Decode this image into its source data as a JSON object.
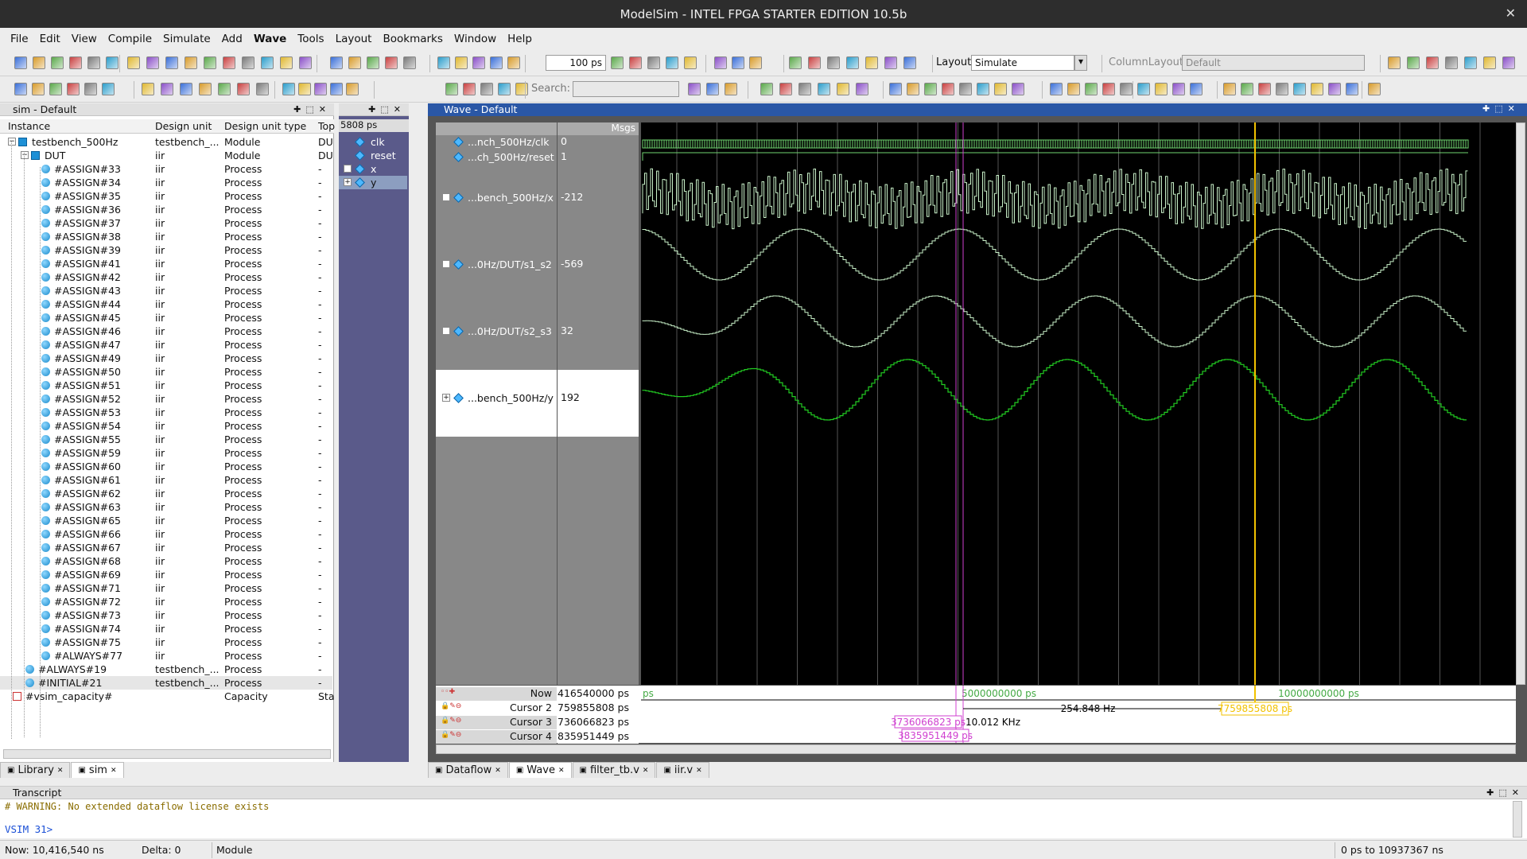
{
  "window": {
    "title": "ModelSim - INTEL FPGA STARTER EDITION 10.5b"
  },
  "menu": [
    "File",
    "Edit",
    "View",
    "Compile",
    "Simulate",
    "Add",
    "Wave",
    "Tools",
    "Layout",
    "Bookmarks",
    "Window",
    "Help"
  ],
  "toolbar": {
    "runtime_value": "100",
    "runtime_unit": "ps",
    "layout_label": "Layout",
    "layout_value": "Simulate",
    "column_layout_label": "ColumnLayout",
    "column_layout_value": "Default",
    "search_label": "Search:",
    "search_placeholder": ""
  },
  "sim_panel": {
    "title": "sim - Default",
    "columns": [
      "Instance",
      "Design unit",
      "Design unit type",
      "Top"
    ],
    "rows": [
      {
        "instance": "testbench_500Hz",
        "unit": "testbench_...",
        "type": "Module",
        "top": "DU",
        "icon": "module-icon",
        "level": 0
      },
      {
        "instance": "DUT",
        "unit": "iir",
        "type": "Module",
        "top": "DU",
        "icon": "module-icon",
        "level": 1
      },
      {
        "instance": "#ASSIGN#33",
        "unit": "iir",
        "type": "Process",
        "top": "-",
        "level": 2
      },
      {
        "instance": "#ASSIGN#34",
        "unit": "iir",
        "type": "Process",
        "top": "-",
        "level": 2
      },
      {
        "instance": "#ASSIGN#35",
        "unit": "iir",
        "type": "Process",
        "top": "-",
        "level": 2
      },
      {
        "instance": "#ASSIGN#36",
        "unit": "iir",
        "type": "Process",
        "top": "-",
        "level": 2
      },
      {
        "instance": "#ASSIGN#37",
        "unit": "iir",
        "type": "Process",
        "top": "-",
        "level": 2
      },
      {
        "instance": "#ASSIGN#38",
        "unit": "iir",
        "type": "Process",
        "top": "-",
        "level": 2
      },
      {
        "instance": "#ASSIGN#39",
        "unit": "iir",
        "type": "Process",
        "top": "-",
        "level": 2
      },
      {
        "instance": "#ASSIGN#41",
        "unit": "iir",
        "type": "Process",
        "top": "-",
        "level": 2
      },
      {
        "instance": "#ASSIGN#42",
        "unit": "iir",
        "type": "Process",
        "top": "-",
        "level": 2
      },
      {
        "instance": "#ASSIGN#43",
        "unit": "iir",
        "type": "Process",
        "top": "-",
        "level": 2
      },
      {
        "instance": "#ASSIGN#44",
        "unit": "iir",
        "type": "Process",
        "top": "-",
        "level": 2
      },
      {
        "instance": "#ASSIGN#45",
        "unit": "iir",
        "type": "Process",
        "top": "-",
        "level": 2
      },
      {
        "instance": "#ASSIGN#46",
        "unit": "iir",
        "type": "Process",
        "top": "-",
        "level": 2
      },
      {
        "instance": "#ASSIGN#47",
        "unit": "iir",
        "type": "Process",
        "top": "-",
        "level": 2
      },
      {
        "instance": "#ASSIGN#49",
        "unit": "iir",
        "type": "Process",
        "top": "-",
        "level": 2
      },
      {
        "instance": "#ASSIGN#50",
        "unit": "iir",
        "type": "Process",
        "top": "-",
        "level": 2
      },
      {
        "instance": "#ASSIGN#51",
        "unit": "iir",
        "type": "Process",
        "top": "-",
        "level": 2
      },
      {
        "instance": "#ASSIGN#52",
        "unit": "iir",
        "type": "Process",
        "top": "-",
        "level": 2
      },
      {
        "instance": "#ASSIGN#53",
        "unit": "iir",
        "type": "Process",
        "top": "-",
        "level": 2
      },
      {
        "instance": "#ASSIGN#54",
        "unit": "iir",
        "type": "Process",
        "top": "-",
        "level": 2
      },
      {
        "instance": "#ASSIGN#55",
        "unit": "iir",
        "type": "Process",
        "top": "-",
        "level": 2
      },
      {
        "instance": "#ASSIGN#59",
        "unit": "iir",
        "type": "Process",
        "top": "-",
        "level": 2
      },
      {
        "instance": "#ASSIGN#60",
        "unit": "iir",
        "type": "Process",
        "top": "-",
        "level": 2
      },
      {
        "instance": "#ASSIGN#61",
        "unit": "iir",
        "type": "Process",
        "top": "-",
        "level": 2
      },
      {
        "instance": "#ASSIGN#62",
        "unit": "iir",
        "type": "Process",
        "top": "-",
        "level": 2
      },
      {
        "instance": "#ASSIGN#63",
        "unit": "iir",
        "type": "Process",
        "top": "-",
        "level": 2
      },
      {
        "instance": "#ASSIGN#65",
        "unit": "iir",
        "type": "Process",
        "top": "-",
        "level": 2
      },
      {
        "instance": "#ASSIGN#66",
        "unit": "iir",
        "type": "Process",
        "top": "-",
        "level": 2
      },
      {
        "instance": "#ASSIGN#67",
        "unit": "iir",
        "type": "Process",
        "top": "-",
        "level": 2
      },
      {
        "instance": "#ASSIGN#68",
        "unit": "iir",
        "type": "Process",
        "top": "-",
        "level": 2
      },
      {
        "instance": "#ASSIGN#69",
        "unit": "iir",
        "type": "Process",
        "top": "-",
        "level": 2
      },
      {
        "instance": "#ASSIGN#71",
        "unit": "iir",
        "type": "Process",
        "top": "-",
        "level": 2
      },
      {
        "instance": "#ASSIGN#72",
        "unit": "iir",
        "type": "Process",
        "top": "-",
        "level": 2
      },
      {
        "instance": "#ASSIGN#73",
        "unit": "iir",
        "type": "Process",
        "top": "-",
        "level": 2
      },
      {
        "instance": "#ASSIGN#74",
        "unit": "iir",
        "type": "Process",
        "top": "-",
        "level": 2
      },
      {
        "instance": "#ASSIGN#75",
        "unit": "iir",
        "type": "Process",
        "top": "-",
        "level": 2
      },
      {
        "instance": "#ALWAYS#77",
        "unit": "iir",
        "type": "Process",
        "top": "-",
        "level": 2
      },
      {
        "instance": "#ALWAYS#19",
        "unit": "testbench_...",
        "type": "Process",
        "top": "-",
        "level": 1
      },
      {
        "instance": "#INITIAL#21",
        "unit": "testbench_...",
        "type": "Process",
        "top": "-",
        "level": 1,
        "selected": true
      },
      {
        "instance": "#vsim_capacity#",
        "unit": "",
        "type": "Capacity",
        "top": "Sta",
        "icon": "capacity-icon",
        "level": 0
      }
    ]
  },
  "objects_panel": {
    "now_value": "5808 ps",
    "signals": [
      {
        "name": "clk",
        "expandable": false
      },
      {
        "name": "reset",
        "expandable": false
      },
      {
        "name": "x",
        "expandable": true
      },
      {
        "name": "y",
        "expandable": true,
        "selected": true
      }
    ]
  },
  "wave_panel": {
    "title": "Wave - Default",
    "msgs_header": "Msgs",
    "signals": [
      {
        "name": "...nch_500Hz/clk",
        "value": "0",
        "expandable": false
      },
      {
        "name": "...ch_500Hz/reset",
        "value": "1",
        "expandable": false
      },
      {
        "name": "...bench_500Hz/x",
        "value": "-212",
        "expandable": true
      },
      {
        "name": "...0Hz/DUT/s1_s2",
        "value": "-569",
        "expandable": true
      },
      {
        "name": "...0Hz/DUT/s2_s3",
        "value": "32",
        "expandable": true
      },
      {
        "name": "...bench_500Hz/y",
        "value": "192",
        "expandable": true,
        "selected": true
      }
    ],
    "cursors": [
      {
        "name": "Now",
        "value": "416540000 ps"
      },
      {
        "name": "Cursor 2",
        "value": "759855808 ps"
      },
      {
        "name": "Cursor 3",
        "value": "736066823 ps"
      },
      {
        "name": "Cursor 4",
        "value": "835951449 ps"
      }
    ],
    "timeline": {
      "ps_label": "ps",
      "tick1": "5000000000 ps",
      "tick2": "10000000000 ps",
      "cursor2_label": "7759855808 ps",
      "delta_label": "254.848 Hz",
      "cursor3_label": "3736066823 ps",
      "freq_label": "10.012 KHz",
      "cursor4_label": "3835951449 ps"
    },
    "colors": {
      "wave_green": "#6fd36f",
      "wave_light": "#c8f0c8",
      "wave_bright": "#22cc22",
      "cursor_yellow": "#f2c200",
      "cursor_magenta": "#d040d0"
    }
  },
  "tabs_left": [
    {
      "label": "Library",
      "icon": "library-icon"
    },
    {
      "label": "sim",
      "icon": "sim-icon",
      "active": true
    }
  ],
  "tabs_right": [
    {
      "label": "Dataflow",
      "icon": "dataflow-icon"
    },
    {
      "label": "Wave",
      "icon": "wave-icon",
      "active": true
    },
    {
      "label": "filter_tb.v",
      "icon": "file-icon"
    },
    {
      "label": "iir.v",
      "icon": "file-icon"
    }
  ],
  "transcript": {
    "title": "Transcript",
    "lines": [
      "# WARNING: No extended dataflow license exists"
    ],
    "prompt": "VSIM 31>"
  },
  "status": {
    "now": "Now: 10,416,540 ns",
    "delta": "Delta: 0",
    "context": "Module",
    "range": "0 ps to 10937367 ns"
  }
}
